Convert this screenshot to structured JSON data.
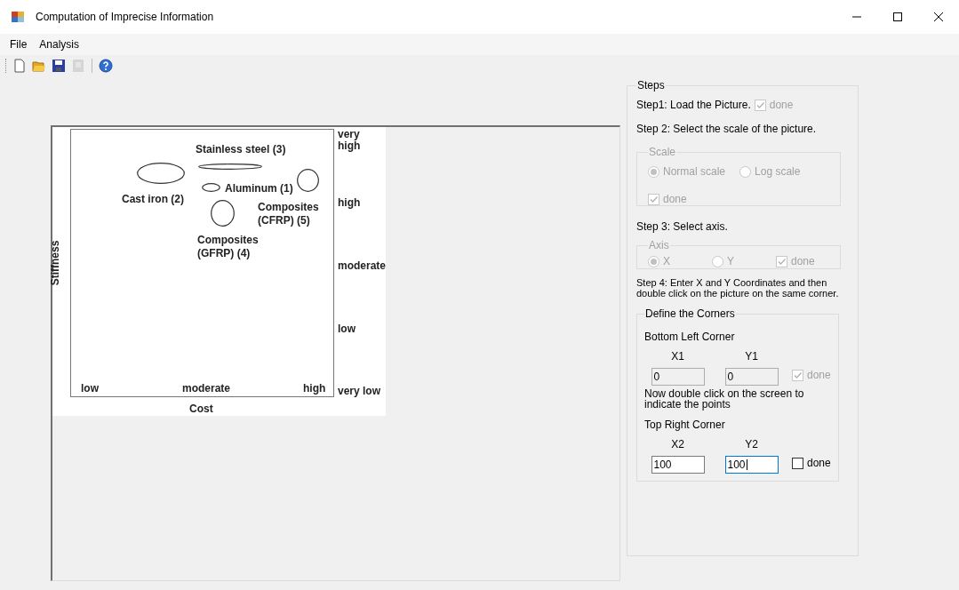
{
  "window": {
    "title": "Computation of Imprecise Information"
  },
  "menu": [
    {
      "label": "File"
    },
    {
      "label": "Analysis"
    }
  ],
  "toolbar": [
    {
      "kind": "new",
      "disabled": false
    },
    {
      "kind": "open",
      "disabled": false
    },
    {
      "kind": "save",
      "disabled": false
    },
    {
      "kind": "export",
      "disabled": true
    },
    {
      "kind": "separator"
    },
    {
      "kind": "help",
      "disabled": false
    }
  ],
  "diagram": {
    "y_axis_label": "Stiffness",
    "x_axis_label": "Cost",
    "x_ticks": [
      "low",
      "moderate",
      "high"
    ],
    "y_ticks": [
      "very high",
      "high",
      "moderate",
      "low",
      "very low"
    ],
    "materials": [
      {
        "label": "Stainless steel (3)"
      },
      {
        "label": "Cast iron (2)"
      },
      {
        "label": "Aluminum (1)"
      },
      {
        "label": "Composites (CFRP) (5)"
      },
      {
        "label": "Composites (GFRP) (4)"
      }
    ]
  },
  "steps": {
    "title": "Steps",
    "step1": {
      "text": "Step1: Load the Picture.",
      "done": {
        "label": "done",
        "checked": true,
        "disabled": true
      }
    },
    "step2_text": "Step 2: Select the scale of the picture.",
    "scale": {
      "title": "Scale",
      "disabled": true,
      "options": [
        {
          "label": "Normal scale",
          "selected": true
        },
        {
          "label": "Log scale",
          "selected": false
        }
      ],
      "done": {
        "label": "done",
        "checked": true
      }
    },
    "step3_text": "Step 3: Select axis.",
    "axis": {
      "title": "Axis",
      "disabled": true,
      "options": [
        {
          "label": "X",
          "selected": true
        },
        {
          "label": "Y",
          "selected": false
        }
      ],
      "done": {
        "label": "done",
        "checked": true
      }
    },
    "step4_text": "Step 4: Enter X and Y Coordinates and then double click on the picture on the same corner.",
    "corners": {
      "title": "Define the Corners",
      "bottom_left": {
        "title": "Bottom Left Corner",
        "disabled": true,
        "fields": [
          {
            "label": "X1",
            "value": "0",
            "focused": false
          },
          {
            "label": "Y1",
            "value": "0",
            "focused": false
          }
        ],
        "done": {
          "label": "done",
          "checked": true
        }
      },
      "note": "Now double click on the screen to indicate the points",
      "top_right": {
        "title": "Top Right Corner",
        "disabled": false,
        "fields": [
          {
            "label": "X2",
            "value": "100",
            "focused": false
          },
          {
            "label": "Y2",
            "value": "100",
            "focused": true
          }
        ],
        "done": {
          "label": "done",
          "checked": false
        }
      }
    }
  }
}
